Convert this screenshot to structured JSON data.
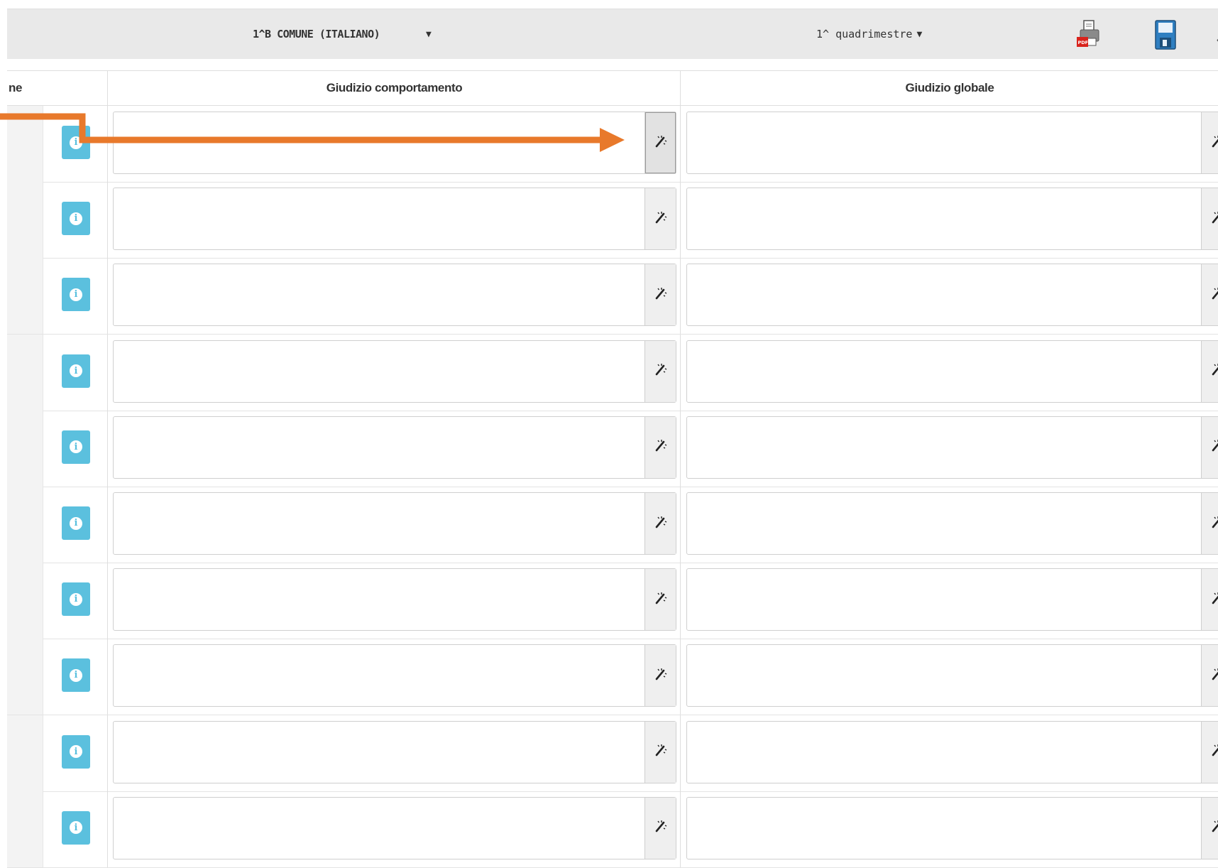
{
  "toolbar": {
    "class_selector": {
      "value": "1^B COMUNE (ITALIANO)",
      "arrow": "▼"
    },
    "period_selector": {
      "value": "1^ quadrimestre",
      "arrow": "▼"
    },
    "pdf_icon": "pdf-printer-icon",
    "save_icon": "floppy-disk-icon"
  },
  "table": {
    "columns": {
      "name": "ne",
      "behavior": "Giudizio comportamento",
      "global": "Giudizio globale"
    },
    "rows": [
      {
        "behavior": "",
        "global": ""
      },
      {
        "behavior": "",
        "global": ""
      },
      {
        "behavior": "",
        "global": ""
      },
      {
        "behavior": "",
        "global": ""
      },
      {
        "behavior": "",
        "global": ""
      },
      {
        "behavior": "",
        "global": ""
      },
      {
        "behavior": "",
        "global": ""
      },
      {
        "behavior": "",
        "global": ""
      },
      {
        "behavior": "",
        "global": ""
      },
      {
        "behavior": "",
        "global": ""
      }
    ],
    "info_icon": "info-icon",
    "wand_icon": "magic-wand-icon"
  },
  "annotation": {
    "color": "#E8792B"
  },
  "colors": {
    "info_button": "#5bc0de",
    "toolbar_bg": "#e9e9e9"
  }
}
